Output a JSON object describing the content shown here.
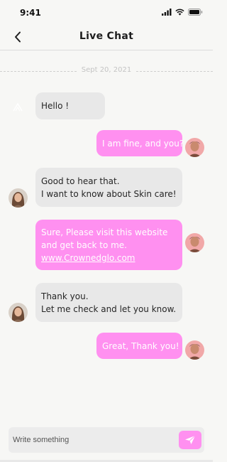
{
  "status_bar": {
    "time": "9:41",
    "icons": [
      "signal-icon",
      "wifi-icon",
      "battery-icon"
    ]
  },
  "header": {
    "title": "Live Chat",
    "back_icon": "chevron-left-icon"
  },
  "date_separator": "Sept 20, 2021",
  "messages": [
    {
      "direction": "incoming",
      "lines": [
        "Hello !"
      ],
      "avatar": "none"
    },
    {
      "direction": "outgoing",
      "lines": [
        "I am fine, and you?"
      ],
      "avatar": "user-avatar"
    },
    {
      "direction": "incoming",
      "lines": [
        "Good to hear that.",
        "I want to know about Skin care!"
      ],
      "avatar": "agent-avatar"
    },
    {
      "direction": "outgoing",
      "lines": [
        "Sure, Please visit this website",
        "and get back to me."
      ],
      "link": "www.Crownedglo.com",
      "avatar": "user-avatar"
    },
    {
      "direction": "incoming",
      "lines": [
        "Thank you.",
        "Let me check and let you know."
      ],
      "avatar": "agent-avatar"
    },
    {
      "direction": "outgoing",
      "lines": [
        "Great, Thank you!"
      ],
      "avatar": "user-avatar"
    }
  ],
  "composer": {
    "placeholder": "Write something",
    "send_icon": "send-icon"
  },
  "colors": {
    "outgoing_bubble": "#ff90f0",
    "incoming_bubble": "#e8e8e8",
    "background": "#f7f7f5"
  }
}
